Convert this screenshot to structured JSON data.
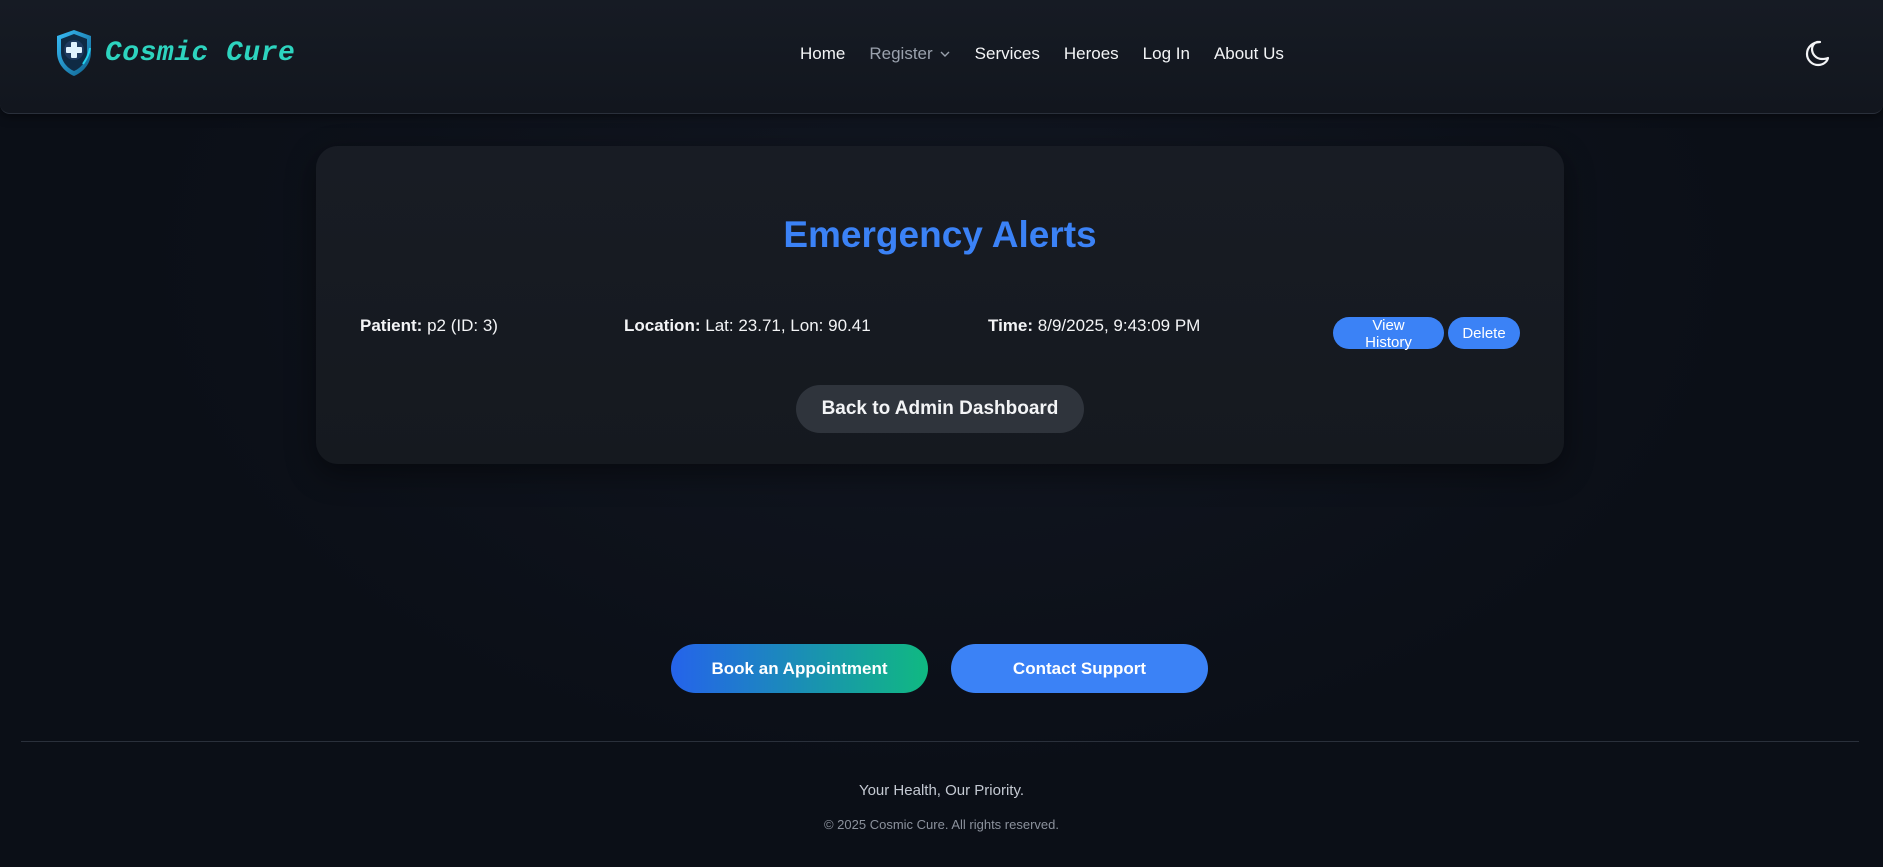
{
  "brand": {
    "name": "Cosmic Cure",
    "icon": "shield-cross-icon"
  },
  "nav": {
    "items": [
      {
        "label": "Home"
      },
      {
        "label": "Register",
        "has_dropdown": true
      },
      {
        "label": "Services"
      },
      {
        "label": "Heroes"
      },
      {
        "label": "Log In"
      },
      {
        "label": "About Us"
      }
    ],
    "theme_icon": "moon-icon"
  },
  "alerts": {
    "title": "Emergency Alerts",
    "items": [
      {
        "patient_label": "Patient:",
        "patient_value": "p2 (ID: 3)",
        "location_label": "Location:",
        "location_value": "Lat: 23.71, Lon: 90.41",
        "time_label": "Time:",
        "time_value": "8/9/2025, 9:43:09 PM",
        "history_button": "View History",
        "delete_button": "Delete"
      }
    ],
    "back_button": "Back to Admin Dashboard"
  },
  "cta": {
    "book": "Book an Appointment",
    "support": "Contact Support"
  },
  "footer": {
    "tagline": "Your Health, Our Priority.",
    "copyright": "© 2025 Cosmic Cure. All rights reserved."
  },
  "colors": {
    "accent": "#3b82f6",
    "brand": "#2dd4bf",
    "background": "#0b0f17",
    "gradient_end": "#10b981"
  }
}
